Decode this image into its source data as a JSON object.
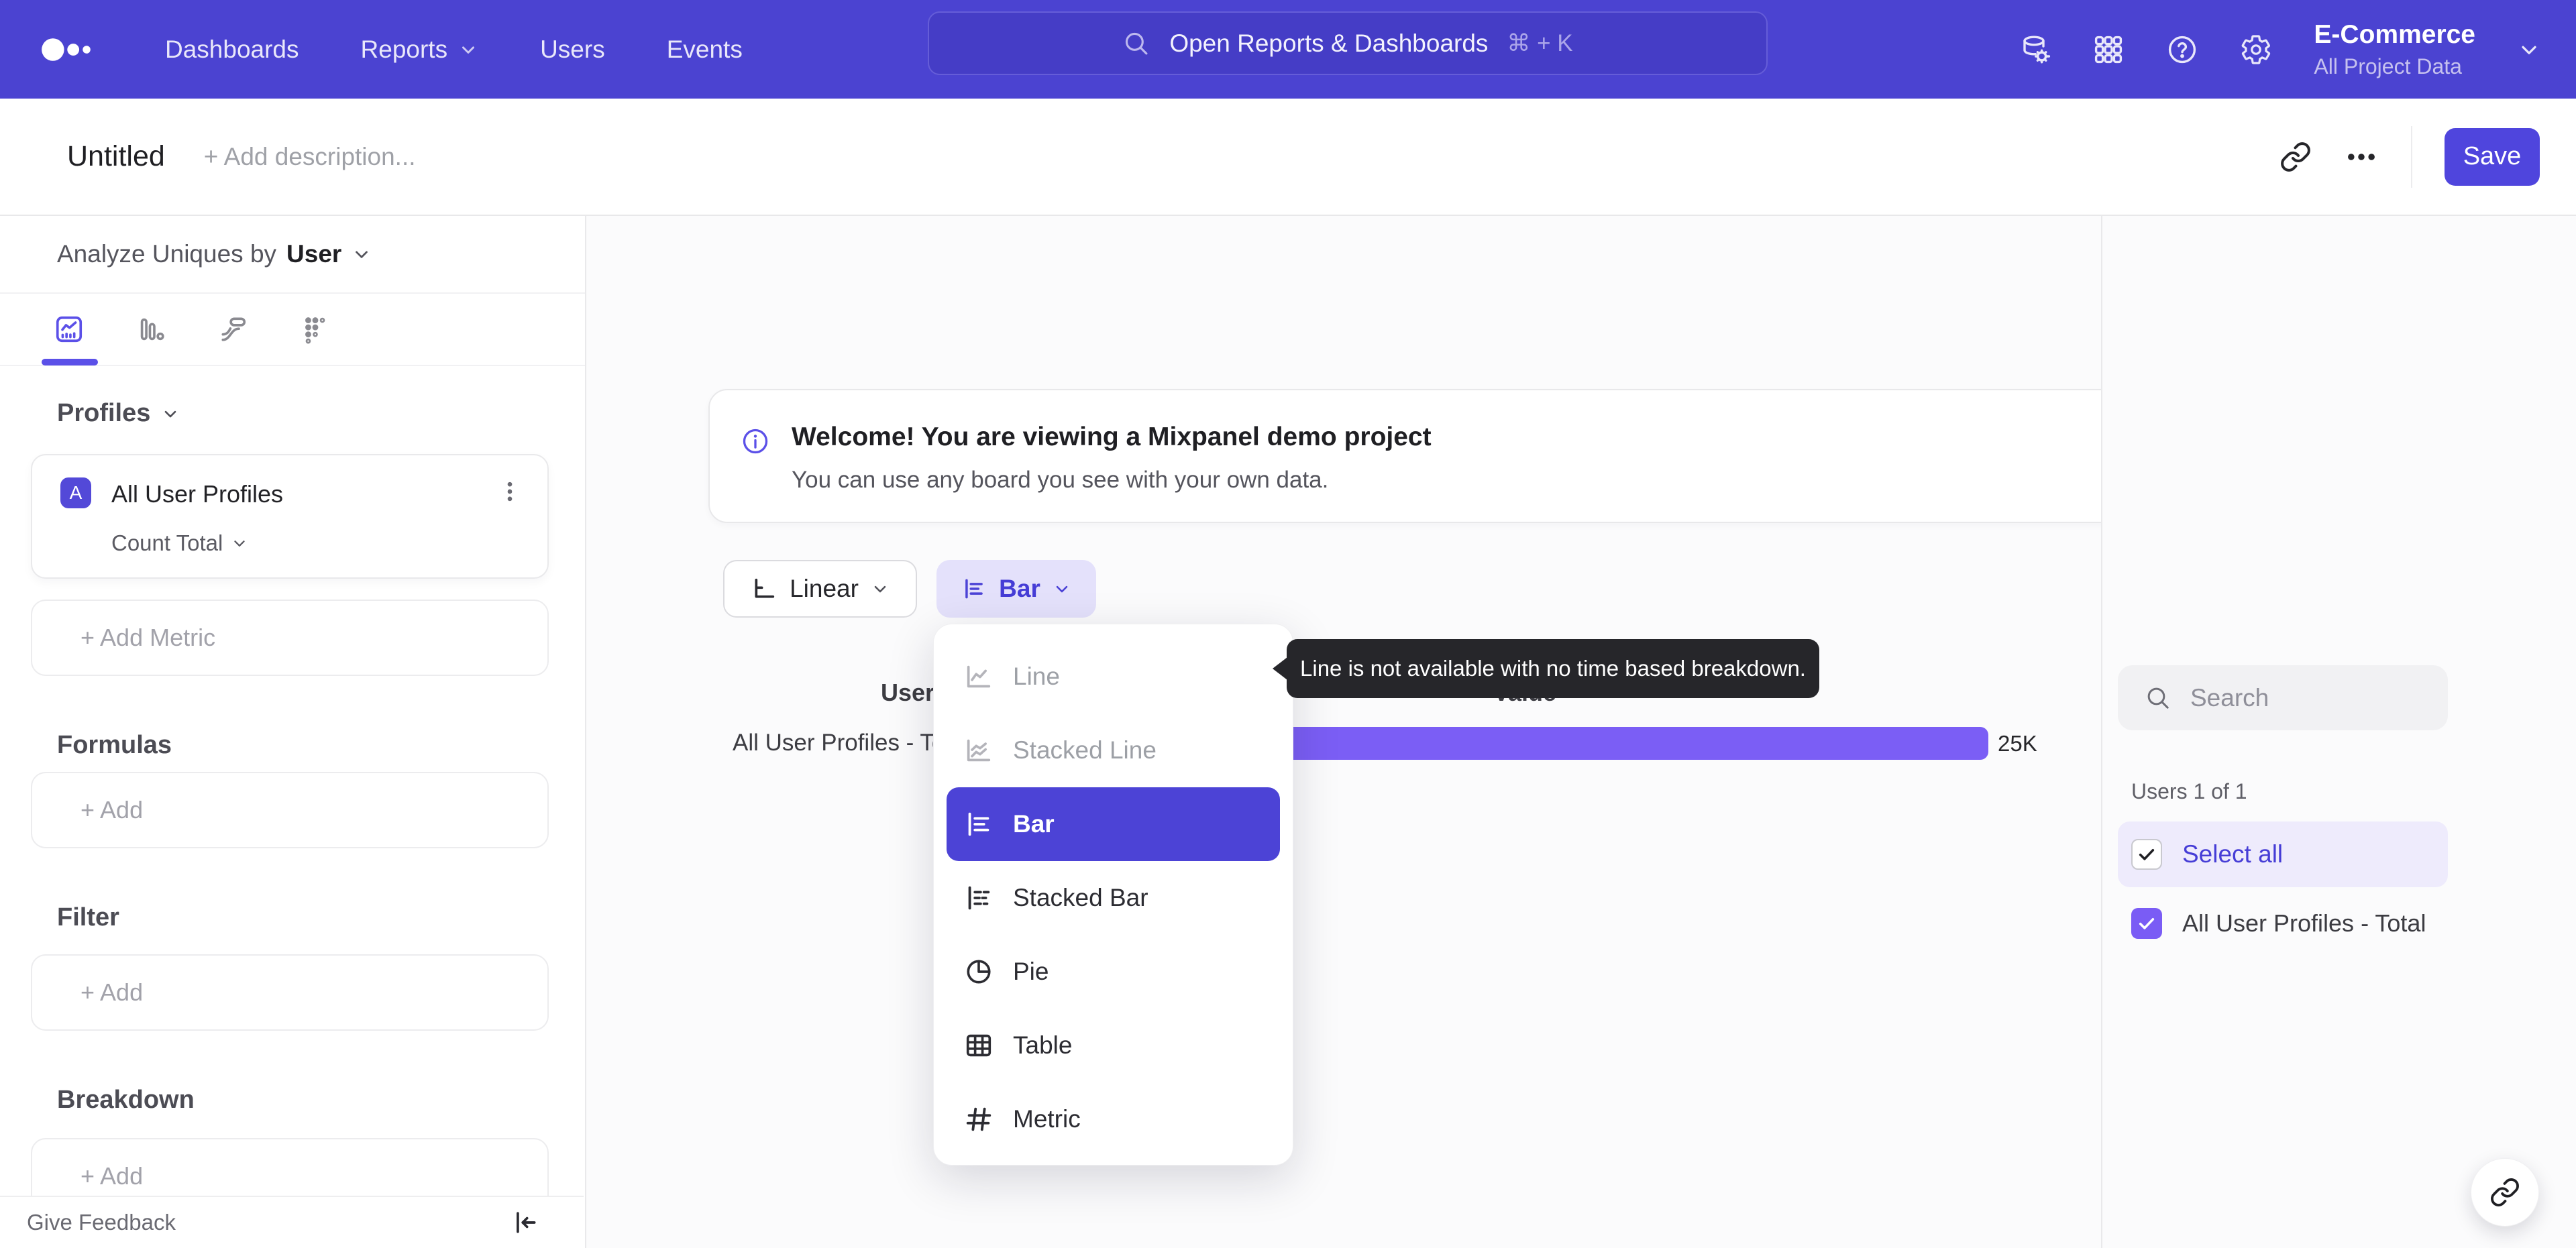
{
  "topnav": {
    "nav_items": [
      {
        "label": "Dashboards"
      },
      {
        "label": "Reports"
      },
      {
        "label": "Users"
      },
      {
        "label": "Events"
      }
    ],
    "search_placeholder": "Open Reports & Dashboards",
    "search_shortcut": "⌘ + K",
    "project_name": "E-Commerce",
    "project_scope": "All Project Data"
  },
  "toolbar": {
    "title": "Untitled",
    "description_placeholder": "+ Add description...",
    "save_label": "Save"
  },
  "sidebar": {
    "analyze_prefix": "Analyze Uniques by",
    "analyze_entity": "User",
    "profiles_heading": "Profiles",
    "metric_card": {
      "badge": "A",
      "name": "All User Profiles",
      "aggregation": "Count Total"
    },
    "add_metric_label": "+ Add Metric",
    "formulas_heading": "Formulas",
    "formulas_add_label": "+ Add",
    "filter_heading": "Filter",
    "filter_add_label": "+ Add",
    "breakdown_heading": "Breakdown",
    "breakdown_add_label": "+ Add",
    "feedback_label": "Give Feedback"
  },
  "main": {
    "banner_title": "Welcome! You are viewing a Mixpanel demo project",
    "banner_subtitle": "You can use any board you see with your own data.",
    "scale_button": "Linear",
    "chart_type_button": "Bar",
    "dropdown_items": [
      {
        "label": "Line",
        "state": "disabled"
      },
      {
        "label": "Stacked Line",
        "state": "disabled"
      },
      {
        "label": "Bar",
        "state": "selected"
      },
      {
        "label": "Stacked Bar",
        "state": "default"
      },
      {
        "label": "Pie",
        "state": "default"
      },
      {
        "label": "Table",
        "state": "default"
      },
      {
        "label": "Metric",
        "state": "default"
      }
    ],
    "tooltip_text": "Line is not available with no time based breakdown.",
    "table": {
      "col_users": "Users",
      "col_value": "Value",
      "row_label": "All User Profiles - Total",
      "row_value": "25K"
    }
  },
  "chart_data": {
    "type": "bar",
    "orientation": "horizontal",
    "categories": [
      "All User Profiles - Total"
    ],
    "values": [
      25000
    ],
    "value_labels": [
      "25K"
    ],
    "bar_color": "#7b5ef5",
    "columns": [
      "Users",
      "Value"
    ]
  },
  "right_panel": {
    "search_placeholder": "Search",
    "count_label": "Users 1 of 1",
    "select_all_label": "Select all",
    "legend_items": [
      {
        "label": "All User Profiles - Total",
        "checked": true
      }
    ]
  },
  "colors": {
    "nav_bg": "#4b43d1",
    "accent": "#4c43d6",
    "bar": "#7b5ef5",
    "save_button": "#4f45dd",
    "light_purple_chip": "#e4e1fb"
  }
}
